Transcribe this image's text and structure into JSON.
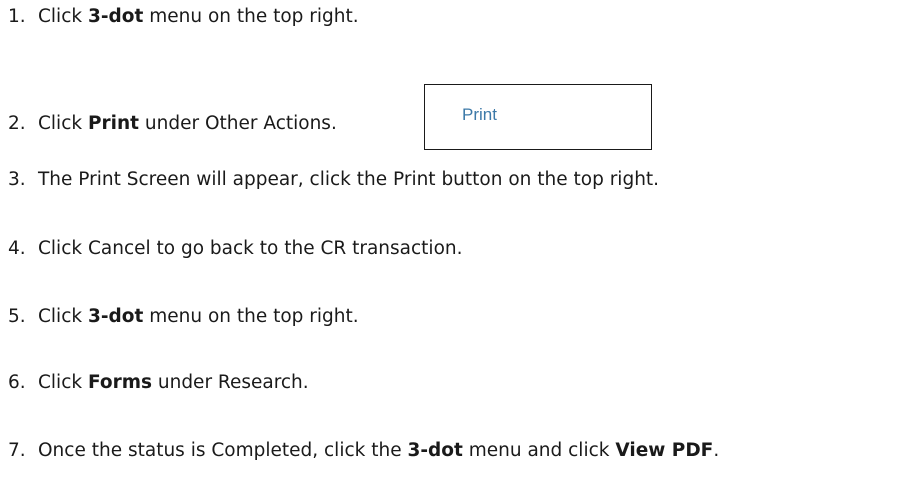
{
  "steps": [
    {
      "num": "1.",
      "pre": "Click ",
      "bold": "3-dot",
      "post": " menu on the top right."
    },
    {
      "num": "2.",
      "pre": "Click ",
      "bold": "Print",
      "post": " under Other Actions."
    },
    {
      "num": "3.",
      "text": "The Print Screen will appear, click the Print button on the top right."
    },
    {
      "num": "4.",
      "text": "Click Cancel to go back to the CR transaction."
    },
    {
      "num": "5.",
      "pre": "Click ",
      "bold": "3-dot",
      "post": " menu on the top right."
    },
    {
      "num": "6.",
      "pre": "Click ",
      "bold": "Forms",
      "post": " under Research."
    },
    {
      "num": "7.",
      "pre": "Once the status is Completed, click the ",
      "bold": "3-dot",
      "mid": " menu and click ",
      "bold2": "View PDF",
      "post": "."
    }
  ],
  "print_snippet": {
    "label": "Print",
    "label_color": "#3c79a8"
  }
}
